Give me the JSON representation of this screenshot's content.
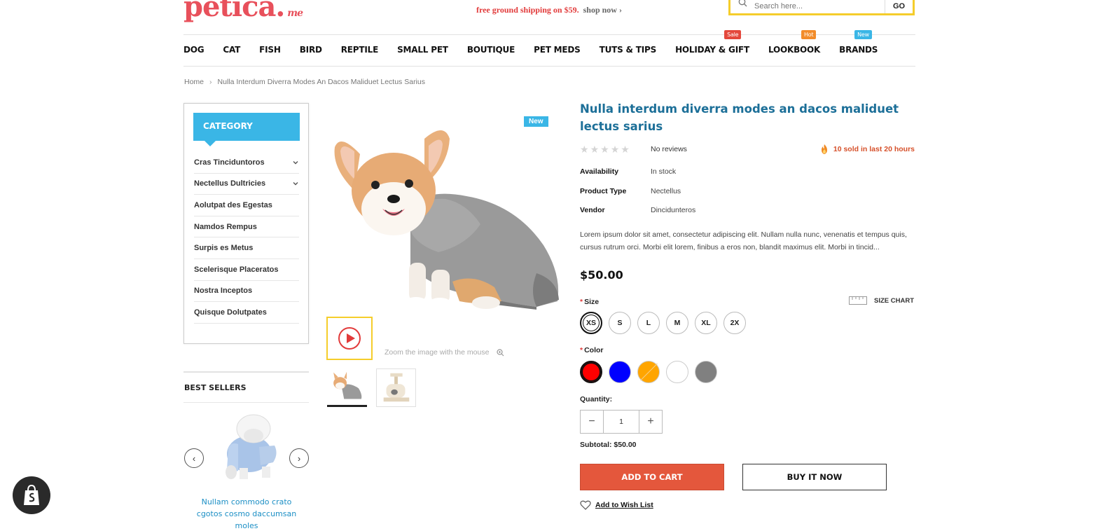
{
  "header": {
    "logo_text": "petica.",
    "logo_suffix": "me",
    "promo_text": "free ground shipping on $59.",
    "promo_link": "shop now",
    "search_placeholder": "Search here...",
    "search_button": "GO"
  },
  "nav": {
    "items": [
      {
        "label": "DOG"
      },
      {
        "label": "CAT"
      },
      {
        "label": "FISH"
      },
      {
        "label": "BIRD"
      },
      {
        "label": "REPTILE"
      },
      {
        "label": "SMALL PET"
      },
      {
        "label": "BOUTIQUE"
      },
      {
        "label": "PET MEDS"
      },
      {
        "label": "TUTS & TIPS"
      },
      {
        "label": "HOLIDAY & GIFT",
        "tag": "Sale"
      },
      {
        "label": "LOOKBOOK",
        "tag": "Hot"
      },
      {
        "label": "BRANDS",
        "tag": "New"
      }
    ]
  },
  "breadcrumb": {
    "home": "Home",
    "current": "Nulla Interdum Diverra Modes An Dacos Maliduet Lectus Sarius"
  },
  "sidebar": {
    "category_title": "CATEGORY",
    "categories": [
      {
        "label": "Cras Tinciduntoros",
        "expandable": true
      },
      {
        "label": "Nectellus Dultricies",
        "expandable": true
      },
      {
        "label": "Aolutpat des Egestas",
        "expandable": false
      },
      {
        "label": "Namdos Rempus",
        "expandable": false
      },
      {
        "label": "Surpis es Metus",
        "expandable": false
      },
      {
        "label": "Scelerisque Placeratos",
        "expandable": false
      },
      {
        "label": "Nostra Inceptos",
        "expandable": false
      },
      {
        "label": "Quisque Dolutpates",
        "expandable": false
      }
    ],
    "best_sellers_title": "BEST SELLERS",
    "best_seller_name": "Nullam commodo crato cgotos cosmo daccumsan moles"
  },
  "gallery": {
    "badge": "New",
    "zoom_hint": "Zoom the image with the mouse"
  },
  "product": {
    "title": "Nulla interdum diverra modes an dacos maliduet lectus sarius",
    "rating": 0,
    "reviews_text": "No reviews",
    "sold_text": "10 sold in last 20 hours",
    "availability_label": "Availability",
    "availability": "In stock",
    "type_label": "Product Type",
    "type": "Nectellus",
    "vendor_label": "Vendor",
    "vendor": "Dincidunteros",
    "description": "Lorem ipsum dolor sit amet, consectetur adipiscing elit. Nullam nulla nunc, venenatis et tempus quis, cursus rutrum orci. Morbi elit lorem, finibus a eros non, blandit maximus elit. Morbi in tincid...",
    "price": "$50.00",
    "size_label": "Size",
    "size_chart": "SIZE CHART",
    "sizes": [
      "XS",
      "S",
      "L",
      "M",
      "XL",
      "2X"
    ],
    "selected_size": "XS",
    "color_label": "Color",
    "colors": [
      {
        "name": "red",
        "hex": "#ff0000",
        "selected": true,
        "sold_out": false
      },
      {
        "name": "blue",
        "hex": "#0000ff",
        "selected": false,
        "sold_out": false
      },
      {
        "name": "orange",
        "hex": "#ffa500",
        "selected": false,
        "sold_out": true
      },
      {
        "name": "white",
        "hex": "#ffffff",
        "selected": false,
        "sold_out": false
      },
      {
        "name": "gray",
        "hex": "#808080",
        "selected": false,
        "sold_out": false
      }
    ],
    "quantity_label": "Quantity:",
    "quantity": "1",
    "subtotal": "Subtotal: $50.00",
    "add_to_cart": "ADD TO CART",
    "buy_now": "BUY IT NOW",
    "wishlist": "Add to Wish List"
  },
  "colors": {
    "accent_blue": "#3ab6e6",
    "title_blue": "#1c6f98",
    "cart_red": "#e4573c",
    "search_yellow": "#f5cd2b"
  }
}
